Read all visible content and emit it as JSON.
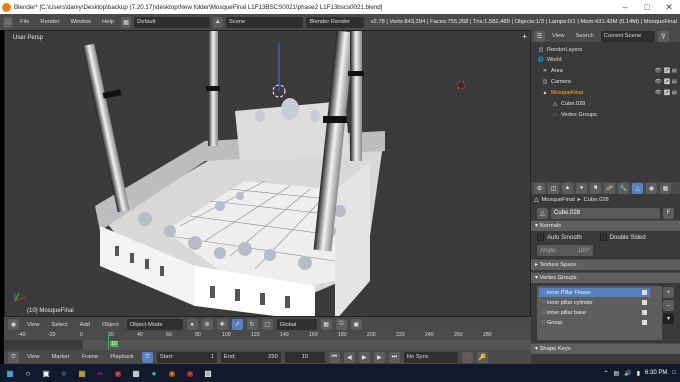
{
  "title_bar": {
    "text": "Blender* [C:\\Users\\daniy\\Desktop\\backup (7.20.17)\\desktop\\New folder\\MosqueFinal L1F13BSCS0021\\phase2 L1F13bscs0021.blend]"
  },
  "header": {
    "menus": [
      "File",
      "Render",
      "Window",
      "Help"
    ],
    "layout": "Default",
    "scene": "Scene",
    "engine": "Blender Render",
    "stats": "v2.78 | Verts:843,394 | Faces:755,268 | Tris:1,582,489 | Objects:1/3 | Lamps:0/1 | Mem:431.43M (0.14M) | MosqueFinal"
  },
  "viewport": {
    "view_label": "User Persp",
    "object_label": "(10) MosqueFinal"
  },
  "viewport_header": {
    "items": [
      "View",
      "Select",
      "Add",
      "Object"
    ],
    "mode": "Object Mode",
    "orientation": "Global"
  },
  "timeline": {
    "ticks": [
      "-40",
      "-20",
      "0",
      "20",
      "40",
      "60",
      "80",
      "100",
      "120",
      "140",
      "160",
      "180",
      "200",
      "220",
      "240",
      "260",
      "280"
    ]
  },
  "timeline_bar": {
    "items": [
      "View",
      "Marker",
      "Frame",
      "Playback"
    ],
    "start_label": "Start:",
    "start": "1",
    "end_label": "End:",
    "end": "250",
    "current": "10",
    "sync": "No Sync"
  },
  "outliner": {
    "tabs": [
      "View",
      "Search"
    ],
    "filter": "Current Scene",
    "items": [
      {
        "label": "RenderLayers"
      },
      {
        "label": "World"
      },
      {
        "label": "Area"
      },
      {
        "label": "Camera"
      },
      {
        "label": "MosqueFinal"
      },
      {
        "label": "Cube.028"
      },
      {
        "label": "Vertex Groups"
      }
    ]
  },
  "properties": {
    "breadcrumb_object": "MosqueFinal",
    "breadcrumb_data": "Cube.028",
    "mesh_name": "Cube.028",
    "mesh_f": "F",
    "normals_header": "Normals",
    "auto_smooth": "Auto Smooth",
    "double_sided": "Double Sided",
    "angle": "Angle:",
    "angle_value": "180°",
    "texture_space": "Texture Space",
    "vertex_groups_header": "Vertex Groups",
    "vertex_groups": [
      "inner Pillar Flower",
      "inner pillar cylinder",
      "inner pillar base",
      "Group"
    ],
    "shape_keys": "Shape Keys"
  },
  "taskbar": {
    "time": "6:30 PM",
    "date": "7/21/2017"
  }
}
